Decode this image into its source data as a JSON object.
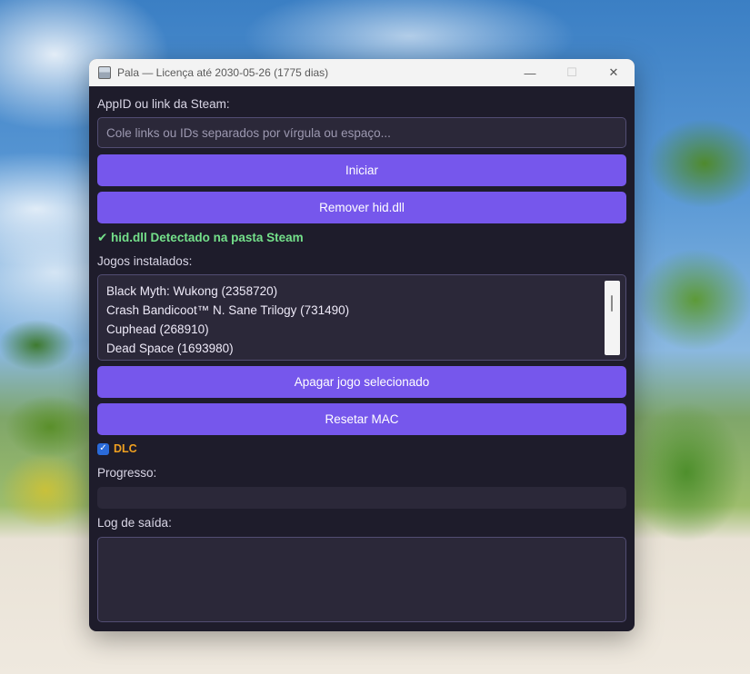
{
  "window": {
    "title": "Pala — Licença até 2030-05-26 (1775 dias)",
    "minimize_glyph": "—",
    "maximize_glyph": "☐",
    "close_glyph": "✕"
  },
  "appid": {
    "label": "AppID ou link da Steam:",
    "value": "",
    "placeholder": "Cole links ou IDs separados por vírgula ou espaço..."
  },
  "buttons": {
    "start": "Iniciar",
    "remove_hid": "Remover hid.dll",
    "delete_game": "Apagar jogo selecionado",
    "reset_mac": "Resetar MAC"
  },
  "status": {
    "text": "✔ hid.dll Detectado na pasta Steam",
    "color": "#74e08a"
  },
  "installed_games": {
    "label": "Jogos instalados:",
    "items": [
      "Black Myth: Wukong (2358720)",
      "Crash Bandicoot™ N. Sane Trilogy (731490)",
      "Cuphead (268910)",
      "Dead Space (1693980)"
    ]
  },
  "dlc": {
    "label": "DLC",
    "checked": true,
    "color": "#f0a020"
  },
  "progress": {
    "label": "Progresso:",
    "value": 0
  },
  "log": {
    "label": "Log de saída:",
    "text": ""
  },
  "colors": {
    "accent": "#7657ec",
    "background": "#1e1c2b",
    "field": "#2b2839",
    "checkbox": "#2a6ad9"
  }
}
